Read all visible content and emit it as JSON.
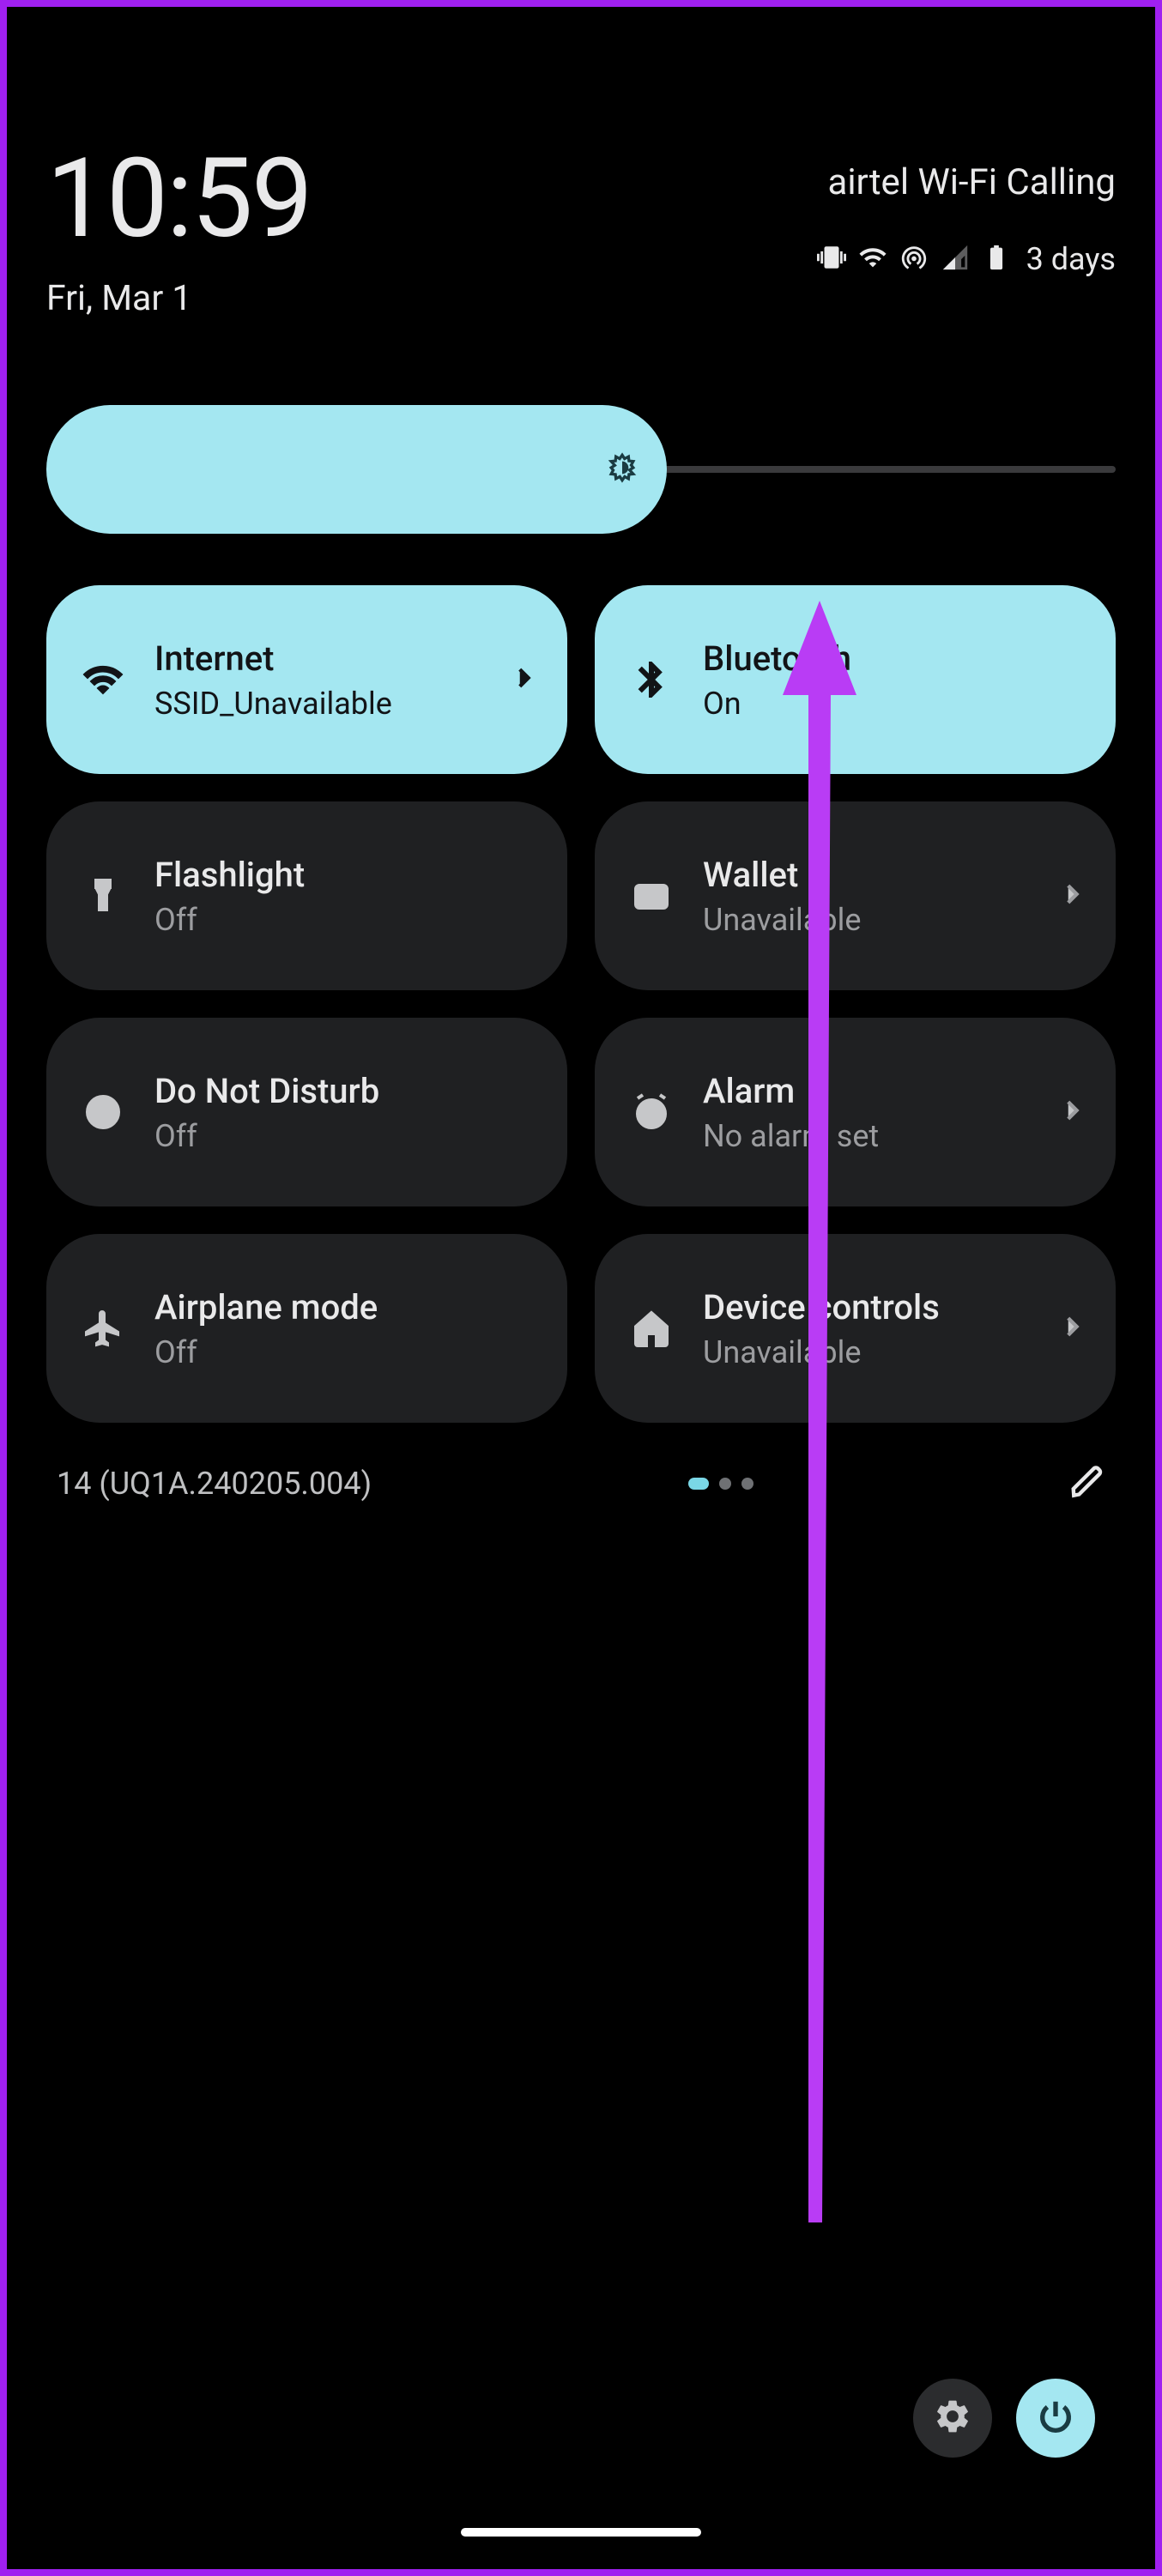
{
  "header": {
    "time": "10:59",
    "date": "Fri, Mar 1",
    "carrier": "airtel Wi-Fi Calling",
    "battery_label": "3 days"
  },
  "brightness": {
    "percent": 58
  },
  "tiles": [
    {
      "id": "internet",
      "title": "Internet",
      "sub": "SSID_Unavailable",
      "active": true,
      "chevron": true
    },
    {
      "id": "bluetooth",
      "title": "Bluetooth",
      "sub": "On",
      "active": true,
      "chevron": false
    },
    {
      "id": "flashlight",
      "title": "Flashlight",
      "sub": "Off",
      "active": false,
      "chevron": false
    },
    {
      "id": "wallet",
      "title": "Wallet",
      "sub": "Unavailable",
      "active": false,
      "chevron": true
    },
    {
      "id": "dnd",
      "title": "Do Not Disturb",
      "sub": "Off",
      "active": false,
      "chevron": false
    },
    {
      "id": "alarm",
      "title": "Alarm",
      "sub": "No alarm set",
      "active": false,
      "chevron": true
    },
    {
      "id": "airplane",
      "title": "Airplane mode",
      "sub": "Off",
      "active": false,
      "chevron": false
    },
    {
      "id": "devicecontrols",
      "title": "Device controls",
      "sub": "Unavailable",
      "active": false,
      "chevron": true
    }
  ],
  "footer": {
    "build": "14 (UQ1A.240205.004)",
    "page_count": 3,
    "active_page": 0
  },
  "annotation": {
    "arrow_color": "#b93cf5"
  }
}
